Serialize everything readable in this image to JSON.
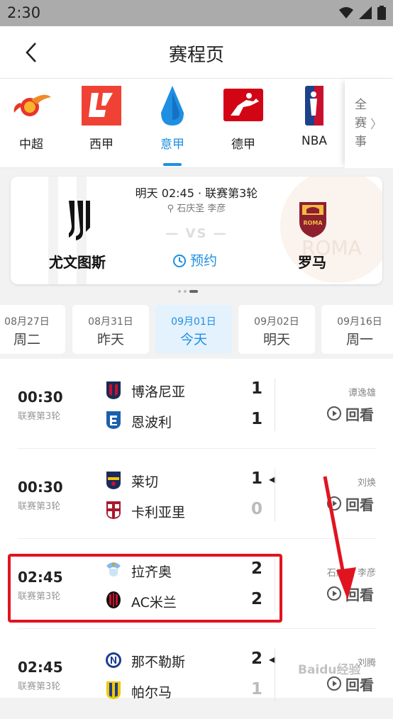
{
  "status": {
    "time": "2:30"
  },
  "header": {
    "title": "赛程页"
  },
  "leagues": [
    {
      "name": "中超",
      "active": false
    },
    {
      "name": "西甲",
      "active": false
    },
    {
      "name": "意甲",
      "active": true
    },
    {
      "name": "德甲",
      "active": false
    },
    {
      "name": "NBA",
      "active": false
    }
  ],
  "all_events": {
    "line1": "全",
    "line2": "赛",
    "line3": "事",
    "chevron": "〉"
  },
  "featured": {
    "time_round": "明天 02:45 · 联赛第3轮",
    "venue": "石庆圣 李彦",
    "vs": "— VS —",
    "home": "尤文图斯",
    "away": "罗马",
    "remind": "预约",
    "away_crest_text": "ROMA"
  },
  "dates": [
    {
      "date": "08月27日",
      "day": "周二",
      "active": false
    },
    {
      "date": "08月31日",
      "day": "昨天",
      "active": false
    },
    {
      "date": "09月01日",
      "day": "今天",
      "active": true
    },
    {
      "date": "09月02日",
      "day": "明天",
      "active": false
    },
    {
      "date": "09月16日",
      "day": "周一",
      "active": false
    }
  ],
  "matches": [
    {
      "time": "00:30",
      "round": "联赛第3轮",
      "home": "博洛尼亚",
      "away": "恩波利",
      "home_score": "1",
      "away_score": "1",
      "referee": "谭逸雄",
      "replay": "回看"
    },
    {
      "time": "00:30",
      "round": "联赛第3轮",
      "home": "莱切",
      "away": "卡利亚里",
      "home_score": "1",
      "away_score": "0",
      "referee": "刘焕",
      "replay": "回看"
    },
    {
      "time": "02:45",
      "round": "联赛第3轮",
      "home": "拉齐奥",
      "away": "AC米兰",
      "home_score": "2",
      "away_score": "2",
      "referee": "石庆圣 李彦",
      "replay": "回看"
    },
    {
      "time": "02:45",
      "round": "联赛第3轮",
      "home": "那不勒斯",
      "away": "帕尔马",
      "home_score": "2",
      "away_score": "1",
      "referee": "刘腾",
      "replay": "回看"
    }
  ],
  "watermark": "Baidu经验",
  "colors": {
    "accent": "#1e8fe1",
    "highlight": "#e01420"
  }
}
